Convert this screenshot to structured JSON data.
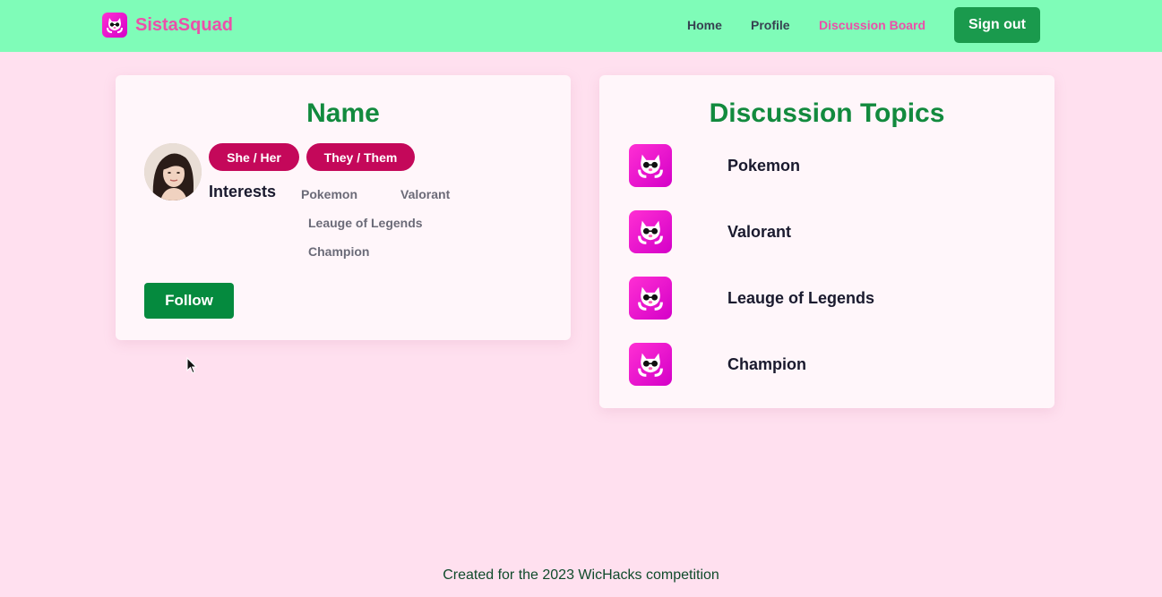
{
  "navbar": {
    "brand": "SistaSquad",
    "links": [
      {
        "label": "Home",
        "active": false
      },
      {
        "label": "Profile",
        "active": false
      },
      {
        "label": "Discussion Board",
        "active": true
      }
    ],
    "signout_label": "Sign out"
  },
  "profile": {
    "title": "Name",
    "pronouns": [
      "She / Her",
      "They / Them"
    ],
    "interests_label": "Interests",
    "interests": [
      "Pokemon",
      "Valorant",
      "Leauge of Legends",
      "Champion"
    ],
    "follow_label": "Follow"
  },
  "topics": {
    "title": "Discussion Topics",
    "items": [
      {
        "name": "Pokemon",
        "icon": "sistasquad-logo-icon"
      },
      {
        "name": "Valorant",
        "icon": "sistasquad-logo-icon"
      },
      {
        "name": "Leauge of Legends",
        "icon": "sistasquad-logo-icon"
      },
      {
        "name": "Champion",
        "icon": "sistasquad-logo-icon"
      }
    ]
  },
  "footer": {
    "text": "Created for the 2023 WicHacks competition"
  },
  "colors": {
    "navbar_bg": "#7ffcb8",
    "page_bg": "#ffe0ef",
    "brand_pink": "#ec4fa9",
    "title_green": "#128a3e",
    "pill_bg": "#c4085a",
    "button_green": "#058a3e",
    "logo_magenta": "#ff2fd3"
  }
}
